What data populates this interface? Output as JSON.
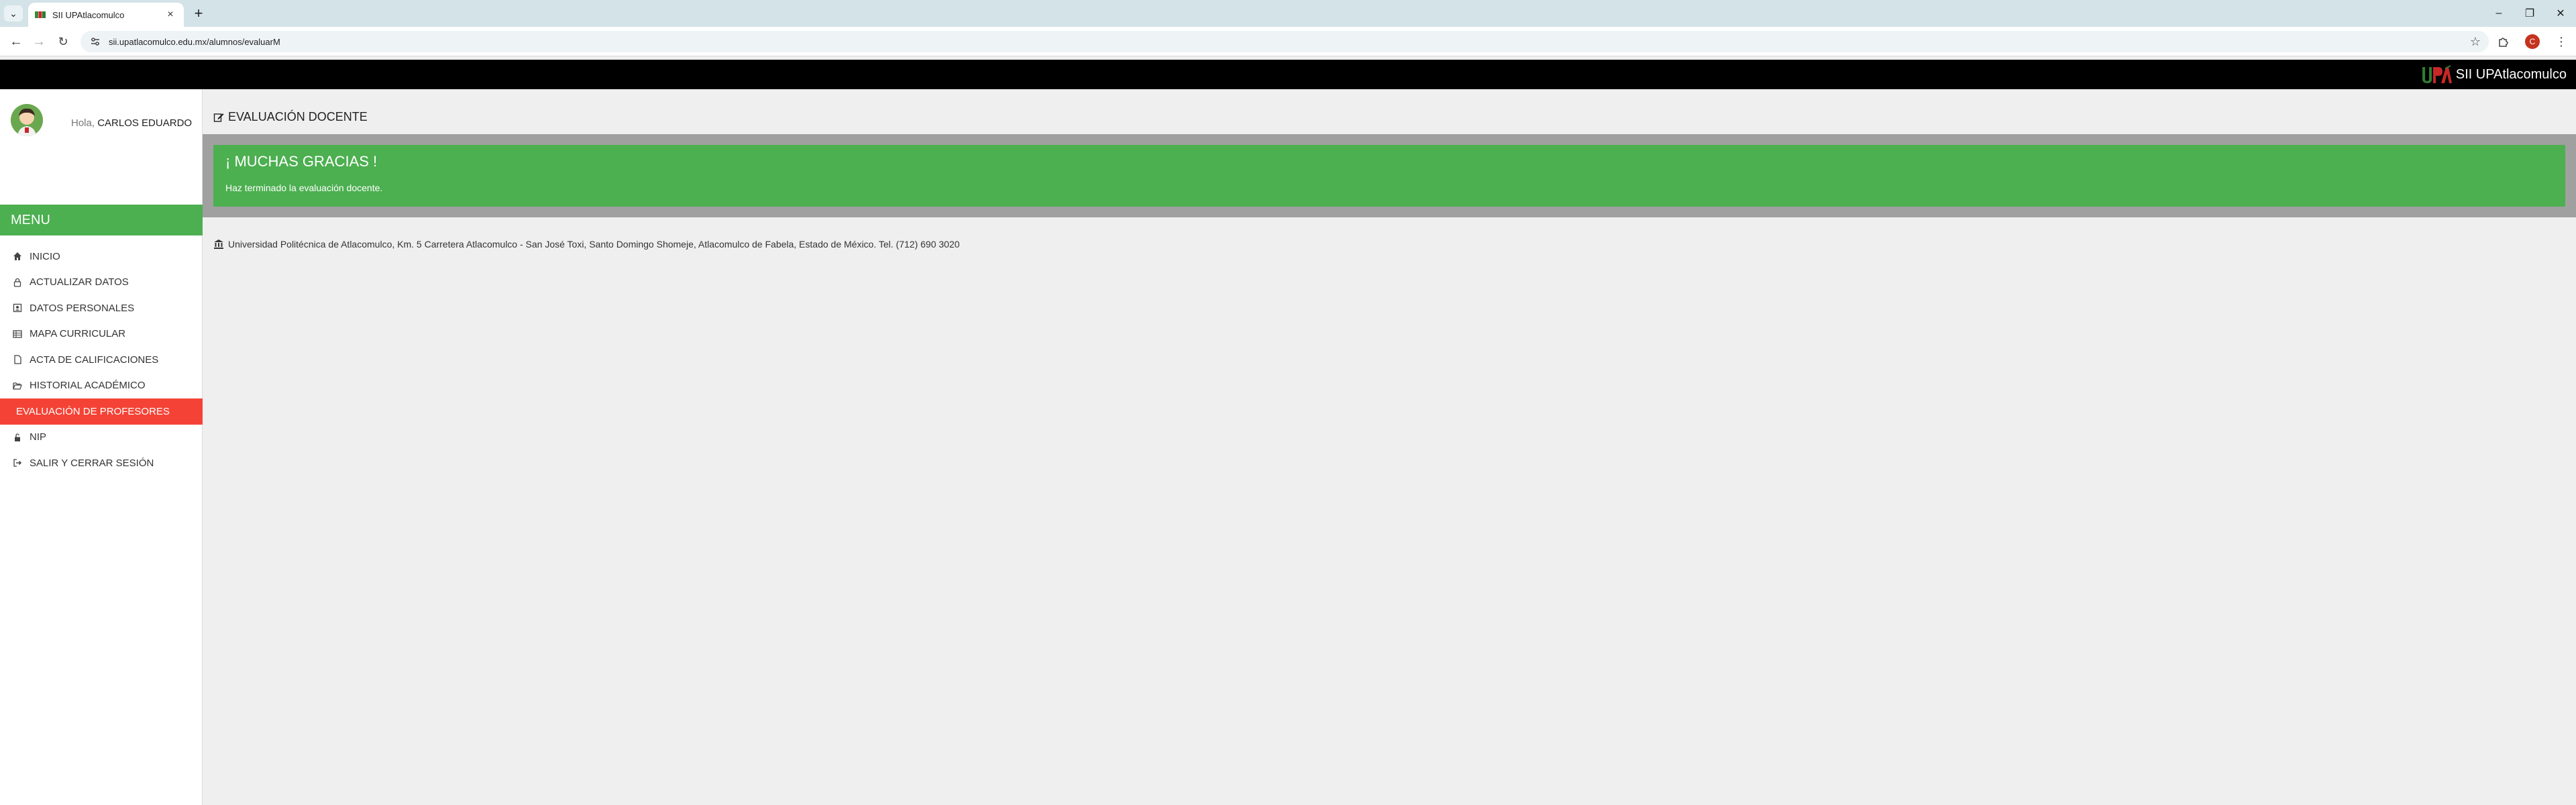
{
  "browser": {
    "tab_title": "SII UPAtlacomulco",
    "url": "sii.upatlacomulco.edu.mx/alumnos/evaluarM",
    "profile_initial": "C"
  },
  "header": {
    "brand_text": "SII UPAtlacomulco"
  },
  "user": {
    "greeting_prefix": "Hola,",
    "name": "CARLOS EDUARDO"
  },
  "menu": {
    "title": "MENU",
    "items": [
      {
        "label": "INICIO",
        "icon": "home-icon"
      },
      {
        "label": "ACTUALIZAR DATOS",
        "icon": "lock-icon"
      },
      {
        "label": "DATOS PERSONALES",
        "icon": "id-card-icon"
      },
      {
        "label": "MAPA CURRICULAR",
        "icon": "table-icon"
      },
      {
        "label": "ACTA DE CALIFICACIONES",
        "icon": "file-icon"
      },
      {
        "label": "HISTORIAL ACADÉMICO",
        "icon": "folder-open-icon"
      },
      {
        "label": "EVALUACIÓN DE PROFESORES",
        "icon": "none",
        "active": true
      },
      {
        "label": "NIP",
        "icon": "unlock-icon"
      },
      {
        "label": "SALIR Y CERRAR SESIÓN",
        "icon": "sign-out-icon"
      }
    ]
  },
  "main": {
    "title": "EVALUACIÓN DOCENTE",
    "alert_title": "¡ MUCHAS GRACIAS !",
    "alert_text": "Haz terminado la evaluación docente."
  },
  "footer": {
    "text": "Universidad Politécnica de Atlacomulco, Km. 5 Carretera Atlacomulco - San José Toxi, Santo Domingo Shomeje, Atlacomulco de Fabela, Estado de México. Tel. (712) 690 3020"
  },
  "colors": {
    "menu_header": "#4caf50",
    "active_item": "#f44336",
    "alert": "#4caf50",
    "panel": "#a0a0a0"
  }
}
